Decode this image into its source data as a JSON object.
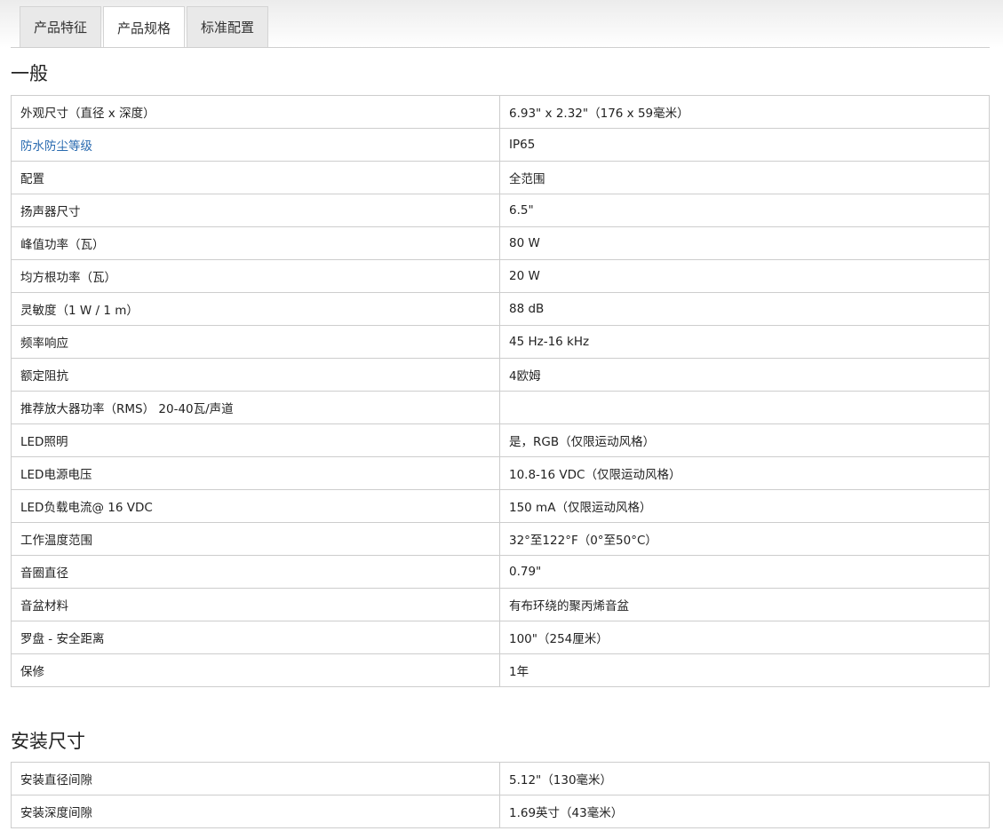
{
  "tabs": [
    {
      "label": "产品特征"
    },
    {
      "label": "产品规格"
    },
    {
      "label": "标准配置"
    }
  ],
  "general": {
    "title": "一般",
    "rows": [
      {
        "label": "外观尺寸（直径 x 深度）",
        "value": "6.93\" x 2.32\"（176 x 59毫米）"
      },
      {
        "label": "防水防尘等级",
        "value": "IP65"
      },
      {
        "label": "配置",
        "value": "全范围"
      },
      {
        "label": "扬声器尺寸",
        "value": "6.5\""
      },
      {
        "label": "峰值功率（瓦）",
        "value": "80 W"
      },
      {
        "label": "均方根功率（瓦）",
        "value": "20 W"
      },
      {
        "label": "灵敏度（1 W / 1 m）",
        "value": "88 dB"
      },
      {
        "label": "频率响应",
        "value": "45 Hz-16 kHz"
      },
      {
        "label": "额定阻抗",
        "value": "4欧姆"
      },
      {
        "label": "推荐放大器功率（RMS） 20-40瓦/声道",
        "value": ""
      },
      {
        "label": "LED照明",
        "value": "是，RGB（仅限运动风格）"
      },
      {
        "label": "LED电源电压",
        "value": "10.8-16 VDC（仅限运动风格）"
      },
      {
        "label": "LED负载电流@ 16 VDC",
        "value": "150 mA（仅限运动风格）"
      },
      {
        "label": "工作温度范围",
        "value": "32°至122°F（0°至50°C）"
      },
      {
        "label": "音圈直径",
        "value": "0.79\""
      },
      {
        "label": "音盆材料",
        "value": "有布环绕的聚丙烯音盆"
      },
      {
        "label": "罗盘 - 安全距离",
        "value": "100\"（254厘米）"
      },
      {
        "label": "保修",
        "value": "1年"
      }
    ]
  },
  "mounting": {
    "title": "安装尺寸",
    "rows": [
      {
        "label": "安装直径间隙",
        "value": "5.12\"（130毫米）"
      },
      {
        "label": "安装深度间隙",
        "value": "1.69英寸（43毫米）"
      }
    ]
  }
}
